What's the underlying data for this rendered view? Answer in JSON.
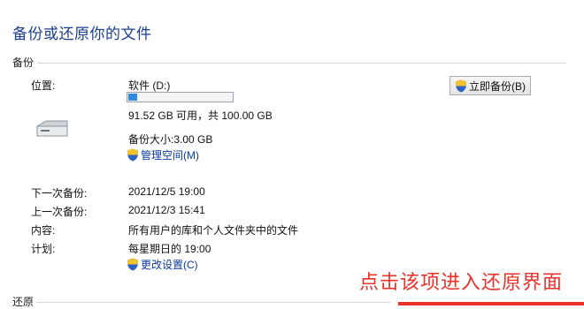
{
  "page": {
    "title": "备份或还原你的文件"
  },
  "backup_section": {
    "heading": "备份",
    "location_label": "位置:",
    "drive_name": "软件 (D:)",
    "usage_fraction": 0.0848,
    "free_text": "91.52 GB 可用，共 100.00 GB",
    "backup_size": "备份大小:3.00 GB",
    "manage_space_link": "管理空间(M)",
    "backup_now_button": "立即备份(B)",
    "next_label": "下一次备份:",
    "next_value": "2021/12/5 19:00",
    "last_label": "上一次备份:",
    "last_value": "2021/12/3 15:41",
    "contents_label": "内容:",
    "contents_value": "所有用户的库和个人文件夹中的文件",
    "schedule_label": "计划:",
    "schedule_value": "每星期日的 19:00",
    "change_settings_link": "更改设置(C)"
  },
  "restore_section": {
    "heading": "还原"
  },
  "annotation": {
    "text": "点击该项进入还原界面"
  },
  "colors": {
    "accent": "#2d8ae0",
    "link": "#0b3a9e",
    "annotation": "#e8322b",
    "title": "#1a3e8c"
  },
  "icons": {
    "drive": "drive-icon",
    "shield": "uac-shield-icon"
  }
}
